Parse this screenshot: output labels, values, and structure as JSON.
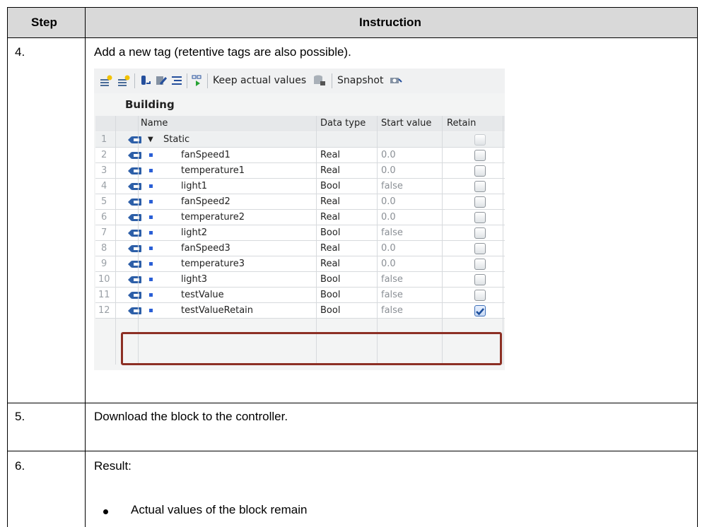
{
  "table": {
    "header": {
      "step": "Step",
      "instruction": "Instruction"
    },
    "rows": [
      {
        "step": "4.",
        "text": "Add a new tag (retentive tags are also possible)."
      },
      {
        "step": "5.",
        "text": "Download the block to the controller."
      },
      {
        "step": "6.",
        "text": "Result:",
        "bullets": [
          "Actual values of the block remain"
        ]
      }
    ]
  },
  "screenshot": {
    "toolbar": {
      "keep_actual_values": "Keep actual values",
      "snapshot": "Snapshot",
      "icons": [
        "add-row-icon",
        "insert-row-icon",
        "db-link-icon",
        "edit-icon",
        "list-icon",
        "monitor-icon",
        "db-icon",
        "camera-icon"
      ]
    },
    "block_title": "Building",
    "columns": {
      "name": "Name",
      "data_type": "Data type",
      "start_value": "Start value",
      "retain": "Retain"
    },
    "rows": [
      {
        "num": "1",
        "name": "Static",
        "type": "",
        "start": "",
        "retain": false
      },
      {
        "num": "2",
        "name": "fanSpeed1",
        "type": "Real",
        "start": "0.0",
        "retain": false
      },
      {
        "num": "3",
        "name": "temperature1",
        "type": "Real",
        "start": "0.0",
        "retain": false
      },
      {
        "num": "4",
        "name": "light1",
        "type": "Bool",
        "start": "false",
        "retain": false
      },
      {
        "num": "5",
        "name": "fanSpeed2",
        "type": "Real",
        "start": "0.0",
        "retain": false
      },
      {
        "num": "6",
        "name": "temperature2",
        "type": "Real",
        "start": "0.0",
        "retain": false
      },
      {
        "num": "7",
        "name": "light2",
        "type": "Bool",
        "start": "false",
        "retain": false
      },
      {
        "num": "8",
        "name": "fanSpeed3",
        "type": "Real",
        "start": "0.0",
        "retain": false
      },
      {
        "num": "9",
        "name": "temperature3",
        "type": "Real",
        "start": "0.0",
        "retain": false
      },
      {
        "num": "10",
        "name": "light3",
        "type": "Bool",
        "start": "false",
        "retain": false
      },
      {
        "num": "11",
        "name": "testValue",
        "type": "Bool",
        "start": "false",
        "retain": false
      },
      {
        "num": "12",
        "name": "testValueRetain",
        "type": "Bool",
        "start": "false",
        "retain": true
      }
    ]
  },
  "colors": {
    "header_bg": "#d9d9d9",
    "highlight_border": "#8c2f24",
    "icon_blue": "#2a5fd6"
  }
}
